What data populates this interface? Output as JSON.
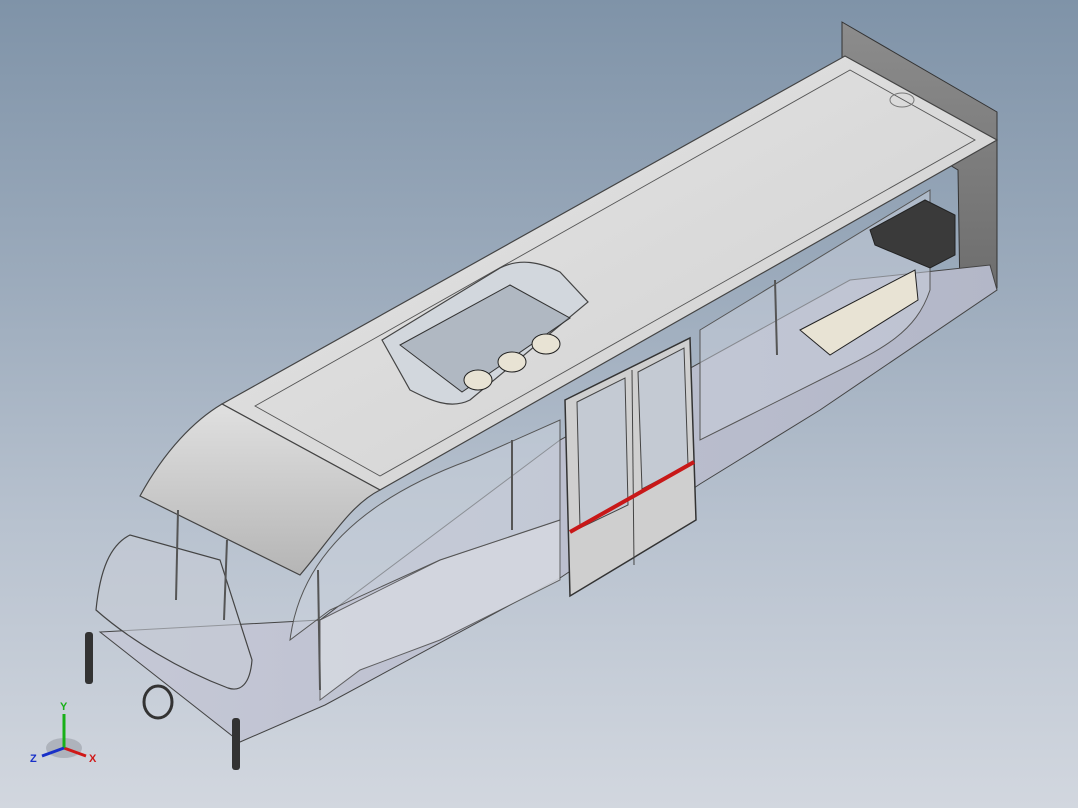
{
  "viewport": {
    "background_top": "#7f93a8",
    "background_bottom": "#d2d7df"
  },
  "triad": {
    "x_label": "X",
    "y_label": "Y",
    "z_label": "Z",
    "x_color": "#d01818",
    "y_color": "#18b018",
    "z_color": "#1830c8"
  },
  "model": {
    "accent_stripe_color": "#c81818",
    "body_color": "#d9d9d9",
    "glass_color": "#bfc8d4"
  }
}
